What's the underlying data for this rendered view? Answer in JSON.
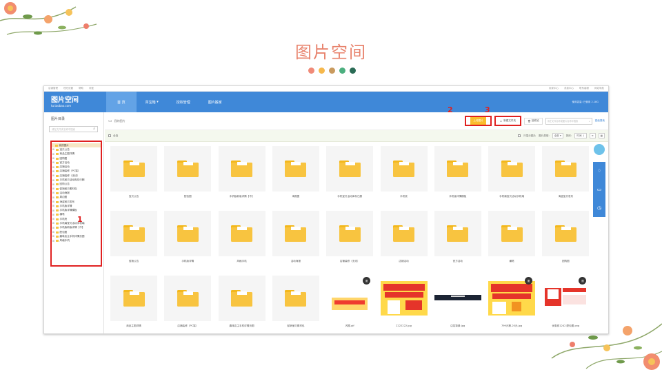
{
  "slide": {
    "title": "图片空间",
    "dot_colors": [
      "#f08a78",
      "#f6b84c",
      "#c99a5e",
      "#4caf7f",
      "#2a6b55"
    ],
    "markers": [
      "1",
      "2",
      "3"
    ]
  },
  "topstrip": {
    "items": [
      "店铺管理",
      "旺旺设置",
      "帮助",
      "淘宝"
    ],
    "right_items": [
      "卖家中心",
      "消息中心",
      "联系客服",
      "网站导航"
    ]
  },
  "nav": {
    "brand_title": "图片空间",
    "brand_subtitle": "tu.taobao.com",
    "tabs": [
      "首 页",
      "百宝箱",
      "授权管理",
      "图片搬家"
    ],
    "right_text": "使用容量: 已使用 2.18G"
  },
  "sidebar": {
    "heading": "图片目录",
    "search_placeholder": "请在文件夹名称中搜索",
    "tree": [
      {
        "label": "我的图片",
        "root": true
      },
      {
        "label": "宝贝公告"
      },
      {
        "label": "商品主图详情"
      },
      {
        "label": "团购图"
      },
      {
        "label": "官方活动"
      },
      {
        "label": "店铺活动"
      },
      {
        "label": "店铺装修（PC端）"
      },
      {
        "label": "店铺装修（无线）"
      },
      {
        "label": "手机宝贝活动库存已删"
      },
      {
        "label": "回购公告"
      },
      {
        "label": "促销宝贝素材包"
      },
      {
        "label": "活动海报"
      },
      {
        "label": "周边图"
      },
      {
        "label": "海盗宝贝发布"
      },
      {
        "label": "手机版详情"
      },
      {
        "label": "手机版详情模板"
      },
      {
        "label": "横笔"
      },
      {
        "label": "手机壳"
      },
      {
        "label": "手机端宝贝活动手机端"
      },
      {
        "label": "手机版新版详情【不】"
      },
      {
        "label": "配包图"
      },
      {
        "label": "趣味店主手机详情页图"
      },
      {
        "label": "风格手机"
      }
    ]
  },
  "toolbar": {
    "breadcrumb": "我的图片",
    "upload_label": "上传图片",
    "new_folder_label": "新建文件夹",
    "recycle_label": "回收站",
    "search_placeholder": "请在文件名称或图片名称中搜索",
    "advanced_label": "高级搜索"
  },
  "filter": {
    "select_all": "全选",
    "only_show": "只显示图片",
    "type_label": "图片类型:",
    "type_value": "全部",
    "sort_label": "排序:",
    "sort_value": "时间",
    "view_list": "≡",
    "view_grid": "▦"
  },
  "items": [
    {
      "name": "宝贝公告",
      "kind": "folder"
    },
    {
      "name": "配包图",
      "kind": "folder"
    },
    {
      "name": "手机版新版详情【不】",
      "kind": "folder"
    },
    {
      "name": "海报图",
      "kind": "folder"
    },
    {
      "name": "手机宝贝活动库存已删",
      "kind": "folder"
    },
    {
      "name": "手机壳",
      "kind": "folder"
    },
    {
      "name": "手机版详情模板",
      "kind": "folder"
    },
    {
      "name": "手机端宝贝活动手机端",
      "kind": "folder"
    },
    {
      "name": "海盗宝贝发布",
      "kind": "folder"
    },
    {
      "name": "促销公告",
      "kind": "folder"
    },
    {
      "name": "手机版详情",
      "kind": "folder"
    },
    {
      "name": "风格手机",
      "kind": "folder"
    },
    {
      "name": "活动海报",
      "kind": "folder"
    },
    {
      "name": "店铺装修（无线）",
      "kind": "folder"
    },
    {
      "name": "店铺活动",
      "kind": "folder"
    },
    {
      "name": "官方活动",
      "kind": "folder"
    },
    {
      "name": "横笔",
      "kind": "folder"
    },
    {
      "name": "团购图",
      "kind": "folder"
    },
    {
      "name": "商品主图详情",
      "kind": "folder"
    },
    {
      "name": "店铺装修（PC端）",
      "kind": "folder"
    },
    {
      "name": "趣味店主手机详情页图",
      "kind": "folder"
    },
    {
      "name": "促销宝贝素材包",
      "kind": "folder"
    },
    {
      "name": "闪图.gif",
      "kind": "image",
      "badge": "图"
    },
    {
      "name": "2222222.jpg",
      "kind": "image"
    },
    {
      "name": "店招背景.jpg",
      "kind": "image"
    },
    {
      "name": "799元第-20元.jpg",
      "kind": "image",
      "badge": "图"
    },
    {
      "name": "优惠券1242 配包图.png",
      "kind": "image",
      "badge": "图"
    }
  ]
}
